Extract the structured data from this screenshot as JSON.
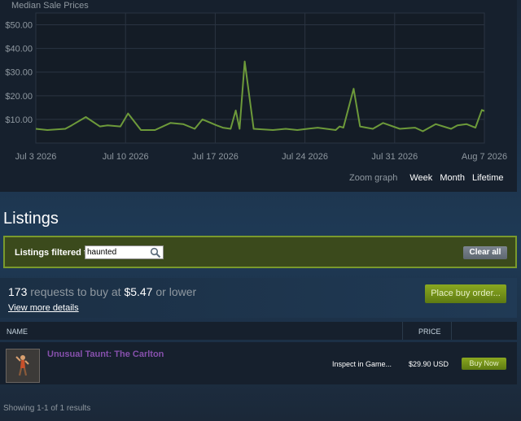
{
  "chart": {
    "title": "Median Sale Prices",
    "zoom": {
      "label": "Zoom graph",
      "options": [
        "Week",
        "Month",
        "Lifetime"
      ]
    }
  },
  "chart_data": {
    "type": "line",
    "title": "Median Sale Prices",
    "xlabel": "",
    "ylabel": "",
    "ylim": [
      0,
      55
    ],
    "yticks": [
      10,
      20,
      30,
      40,
      50
    ],
    "ytick_labels": [
      "$10.00",
      "$20.00",
      "$30.00",
      "$40.00",
      "$50.00"
    ],
    "xtick_labels": [
      "Jul 3 2026",
      "Jul 10 2026",
      "Jul 17 2026",
      "Jul 24 2026",
      "Jul 31 2026",
      "Aug 7 2026"
    ],
    "xrange_days": [
      0,
      35
    ],
    "grid": true,
    "color": "#6d9a3a",
    "series": [
      {
        "days": [
          0,
          0.9,
          2.3,
          2.8,
          3.9,
          5.0,
          5.6,
          6.6,
          7.2,
          8.2,
          9.3,
          10.5,
          11.5,
          12.4,
          13.0,
          14.1,
          14.6,
          15.2,
          15.6,
          15.9,
          16.3,
          17.0,
          18.5,
          19.5,
          20.4,
          21.2,
          22.0,
          23.4,
          23.7,
          24.0,
          24.8,
          25.3,
          26.3,
          27.1,
          28.4,
          29.6,
          30.2,
          31.2,
          32.4,
          32.9,
          33.6,
          34.3,
          34.8,
          35
        ],
        "values": [
          6.0,
          5.5,
          6.0,
          7.5,
          11.0,
          7.0,
          7.5,
          7.0,
          12.5,
          5.5,
          5.5,
          8.5,
          8.0,
          6.0,
          10.0,
          7.5,
          6.5,
          6.0,
          13.8,
          6.0,
          34.5,
          6.0,
          5.5,
          6.0,
          5.5,
          6.0,
          6.5,
          5.5,
          7.0,
          6.5,
          23.0,
          7.0,
          6.0,
          8.5,
          6.0,
          6.5,
          5.0,
          8.0,
          6.0,
          7.5,
          8.0,
          6.5,
          14.0,
          13.5
        ]
      }
    ]
  },
  "listings": {
    "title": "Listings",
    "filter_label": "Listings filtered to:",
    "filter_value": "haunted",
    "clear_label": "Clear all",
    "buy_requests": {
      "count": "173",
      "text": "requests to buy at",
      "price": "$5.47",
      "suffix": "or lower"
    },
    "view_details": "View more details",
    "place_order": "Place buy order...",
    "columns": {
      "name": "NAME",
      "price": "PRICE"
    },
    "rows": [
      {
        "name": "Unusual Taunt: The Carlton",
        "inspect": "Inspect in Game...",
        "price": "$29.90 USD",
        "action": "Buy Now"
      }
    ],
    "results": "Showing 1-1 of 1 results"
  }
}
